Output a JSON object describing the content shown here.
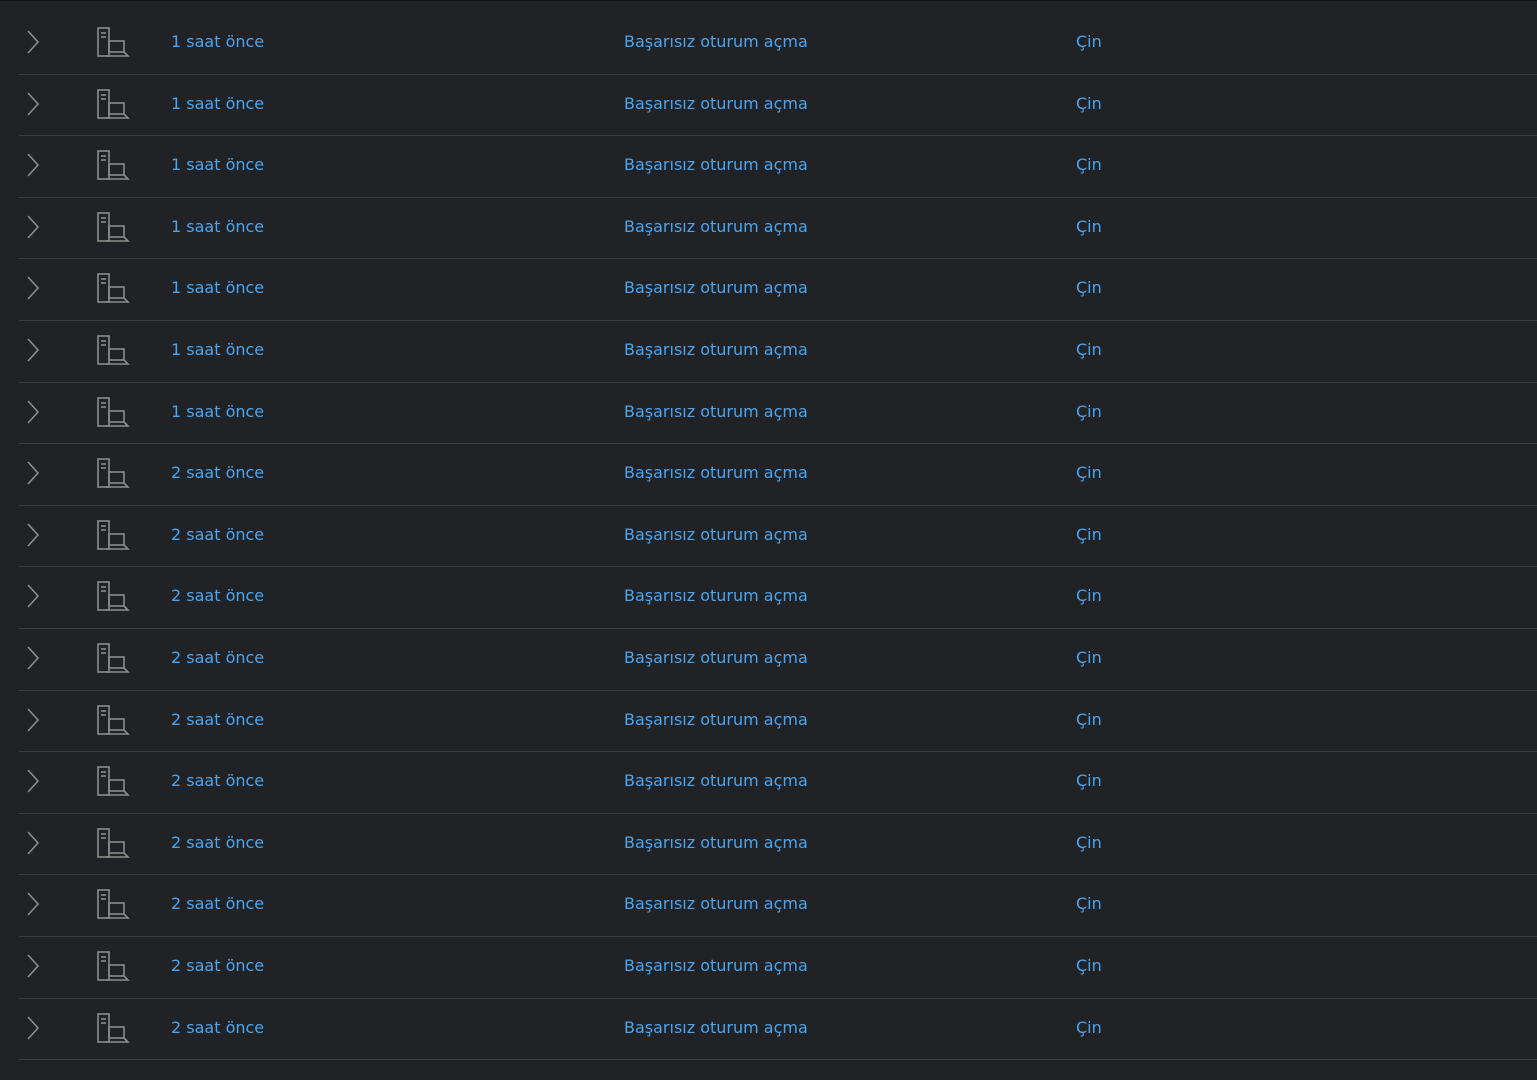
{
  "colors": {
    "background": "#212225",
    "link": "#4aa5f0",
    "divider": "#3b3c3f",
    "icon": "#8c8c8c"
  },
  "icons": {
    "expand": "chevron-right-icon",
    "device": "server-computer-icon"
  },
  "rows": [
    {
      "time": "1 saat önce",
      "event": "Başarısız oturum açma",
      "location": "Çin"
    },
    {
      "time": "1 saat önce",
      "event": "Başarısız oturum açma",
      "location": "Çin"
    },
    {
      "time": "1 saat önce",
      "event": "Başarısız oturum açma",
      "location": "Çin"
    },
    {
      "time": "1 saat önce",
      "event": "Başarısız oturum açma",
      "location": "Çin"
    },
    {
      "time": "1 saat önce",
      "event": "Başarısız oturum açma",
      "location": "Çin"
    },
    {
      "time": "1 saat önce",
      "event": "Başarısız oturum açma",
      "location": "Çin"
    },
    {
      "time": "1 saat önce",
      "event": "Başarısız oturum açma",
      "location": "Çin"
    },
    {
      "time": "2 saat önce",
      "event": "Başarısız oturum açma",
      "location": "Çin"
    },
    {
      "time": "2 saat önce",
      "event": "Başarısız oturum açma",
      "location": "Çin"
    },
    {
      "time": "2 saat önce",
      "event": "Başarısız oturum açma",
      "location": "Çin"
    },
    {
      "time": "2 saat önce",
      "event": "Başarısız oturum açma",
      "location": "Çin"
    },
    {
      "time": "2 saat önce",
      "event": "Başarısız oturum açma",
      "location": "Çin"
    },
    {
      "time": "2 saat önce",
      "event": "Başarısız oturum açma",
      "location": "Çin"
    },
    {
      "time": "2 saat önce",
      "event": "Başarısız oturum açma",
      "location": "Çin"
    },
    {
      "time": "2 saat önce",
      "event": "Başarısız oturum açma",
      "location": "Çin"
    },
    {
      "time": "2 saat önce",
      "event": "Başarısız oturum açma",
      "location": "Çin"
    },
    {
      "time": "2 saat önce",
      "event": "Başarısız oturum açma",
      "location": "Çin"
    }
  ]
}
